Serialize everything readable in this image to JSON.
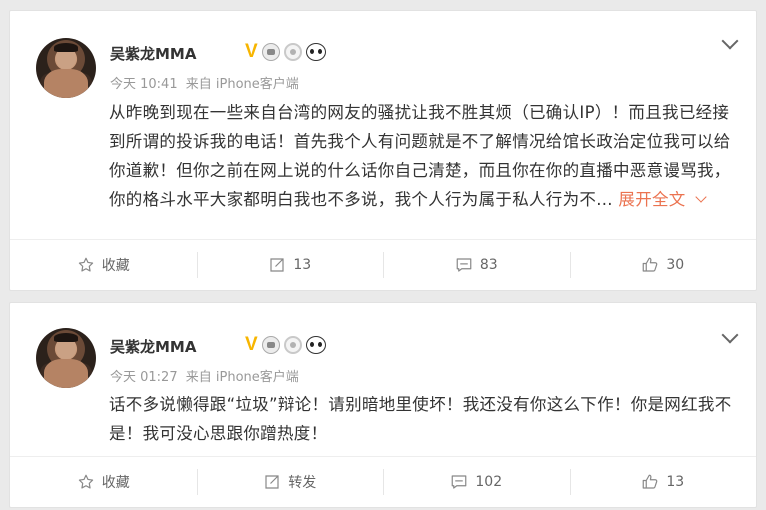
{
  "posts": [
    {
      "author": "吴紫龙MMA",
      "badge_v": "V",
      "time": "今天 10:41",
      "source": "来自 iPhone客户端",
      "text": "从昨晚到现在一些来自台湾的网友的骚扰让我不胜其烦（已确认IP）！而且我已经接到所谓的投诉我的电话！首先我个人有问题就是不了解情况给馆长政治定位我可以给你道歉！但你之前在网上说的什么话你自己清楚，而且你在你的直播中恶意谩骂我，你的格斗水平大家都明白我也不多说，我个人行为属于私人行为不...",
      "expand": "展开全文",
      "actions": {
        "favorite": "收藏",
        "repost": "13",
        "comment": "83",
        "like": "30"
      }
    },
    {
      "author": "吴紫龙MMA",
      "badge_v": "V",
      "time": "今天 01:27",
      "source": "来自 iPhone客户端",
      "text": "话不多说懒得跟“垃圾”辩论！请别暗地里使坏！我还没有你这么下作！你是网红我不是！我可没心思跟你蹭热度！",
      "expand": "",
      "actions": {
        "favorite": "收藏",
        "repost": "转发",
        "comment": "102",
        "like": "13"
      }
    }
  ],
  "colors": {
    "verified": "#f7b500",
    "expand_link": "#eb7350",
    "meta": "#999999"
  },
  "icons": [
    "star-icon",
    "repost-icon",
    "comment-icon",
    "thumbs-up-icon",
    "chevron-down-icon"
  ]
}
